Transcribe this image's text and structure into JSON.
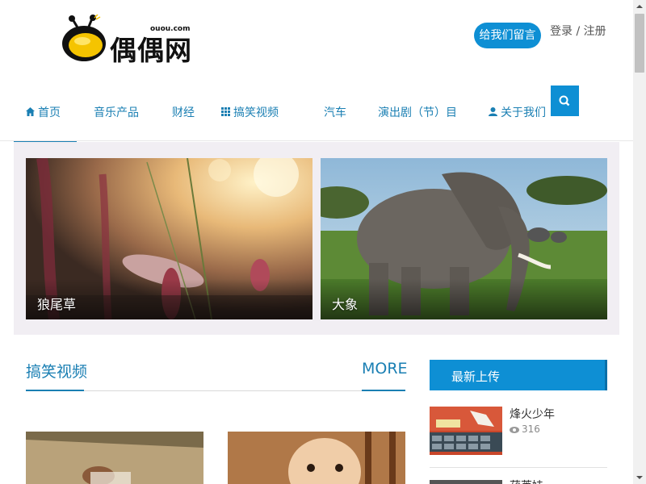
{
  "header": {
    "logo_text": "偶偶网",
    "logo_domain": "ouou.com",
    "message_button": "给我们留言",
    "login_link": "登录",
    "login_separator": " / ",
    "register_link": "注册"
  },
  "nav": {
    "items": [
      {
        "label": "首页",
        "icon": "home-icon",
        "active": true
      },
      {
        "label": "音乐产品",
        "icon": ""
      },
      {
        "label": "财经",
        "icon": ""
      },
      {
        "label": "搞笑视频",
        "icon": "grid-icon"
      },
      {
        "label": "汽车",
        "icon": ""
      },
      {
        "label": "演出剧（节）目",
        "icon": ""
      },
      {
        "label": "关于我们",
        "icon": "user-icon"
      }
    ],
    "search_icon": "search-icon"
  },
  "banner": {
    "slides": [
      {
        "caption": "狼尾草"
      },
      {
        "caption": "大象"
      }
    ]
  },
  "section": {
    "title": "搞笑视频",
    "more": "MORE"
  },
  "sidebar": {
    "title": "最新上传",
    "items": [
      {
        "title": "烽火少年",
        "views": "316",
        "view_icon": "eye-icon"
      },
      {
        "title": "葫芦娃",
        "views": ""
      }
    ]
  },
  "colors": {
    "accent": "#0e8fd4",
    "link": "#1a7fb3",
    "banner_bg": "#f1eef3"
  }
}
